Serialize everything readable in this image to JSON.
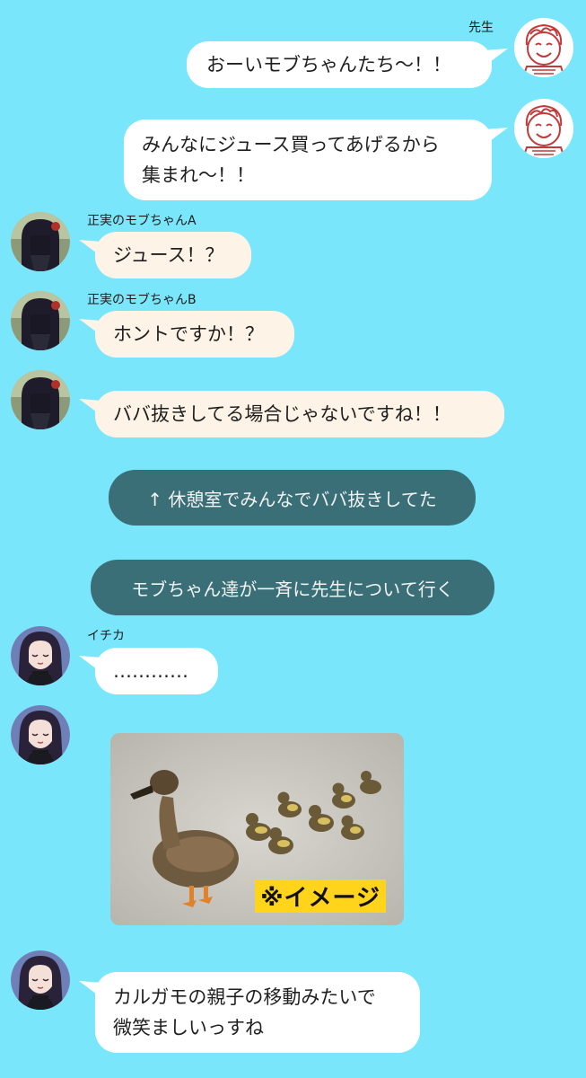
{
  "messages": [
    {
      "side": "right",
      "sender": "先生",
      "avatar": "sensei-avatar",
      "lines": [
        "おーいモブちゃんたち〜！！"
      ]
    },
    {
      "side": "right",
      "sender": "",
      "avatar": "sensei-avatar",
      "lines": [
        "みんなにジュース買ってあげるから",
        "集まれ〜！！"
      ]
    },
    {
      "side": "left",
      "sender": "正実のモブちゃんA",
      "avatar": "mob-avatar",
      "lines": [
        "ジュース！？"
      ]
    },
    {
      "side": "left",
      "sender": "正実のモブちゃんB",
      "avatar": "mob-avatar",
      "lines": [
        "ホントですか！？"
      ]
    },
    {
      "side": "left",
      "sender": "",
      "avatar": "mob-avatar",
      "lines": [
        "ババ抜きしてる場合じゃないですね！！"
      ]
    },
    {
      "side": "left",
      "sender": "イチカ",
      "avatar": "ichika-avatar",
      "lines": [
        "…………"
      ]
    },
    {
      "side": "left",
      "sender": "",
      "avatar": "ichika-avatar",
      "lines": [
        "カルガモの親子の移動みたいで",
        "微笑ましいっすね"
      ]
    }
  ],
  "system_messages": [
    "↑ 休憩室でみんなでババ抜きしてた",
    "モブちゃん達が一斉に先生について行く"
  ],
  "photo": {
    "label": "※イメージ",
    "subject": "duck-with-ducklings"
  },
  "colors": {
    "background": "#7ae6fb",
    "bubble": "#ffffff",
    "bubble_cream": "#fdf3e6",
    "system": "#3a6f78"
  }
}
